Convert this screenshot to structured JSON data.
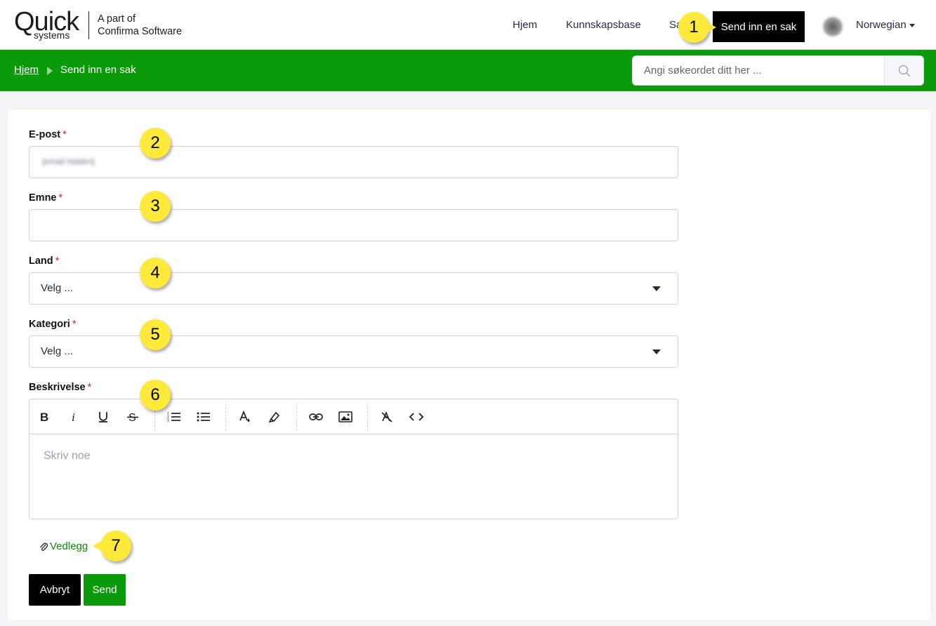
{
  "brand": {
    "logo_main": "Quick",
    "logo_sub": "systems",
    "tagline_1": "A part of",
    "tagline_2": "Confirma Software"
  },
  "topnav": {
    "home": "Hjem",
    "knowledge_base": "Kunnskapsbase",
    "cases_partial": "Sa",
    "submit_case": "Send inn en sak",
    "language": "Norwegian"
  },
  "breadcrumb": {
    "home": "Hjem",
    "current": "Send inn en sak"
  },
  "search": {
    "placeholder": "Angi søkeordet ditt her ..."
  },
  "form": {
    "email": {
      "label": "E-post",
      "value": "[email hidden]"
    },
    "subject": {
      "label": "Emne",
      "value": ""
    },
    "country": {
      "label": "Land",
      "selected": "Velg ..."
    },
    "category": {
      "label": "Kategori",
      "selected": "Velg ..."
    },
    "description": {
      "label": "Beskrivelse",
      "placeholder": "Skriv noe"
    },
    "required_mark": "*",
    "attachment": "Vedlegg",
    "cancel": "Avbryt",
    "send": "Send"
  },
  "callouts": [
    "1",
    "2",
    "3",
    "4",
    "5",
    "6",
    "7"
  ],
  "colors": {
    "brand_green": "#0a9a0a",
    "callout_yellow": "#ffe93a",
    "required_red": "#c62828"
  }
}
